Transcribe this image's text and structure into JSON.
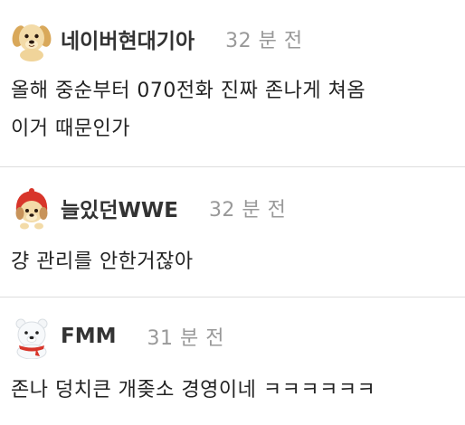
{
  "comments": [
    {
      "avatar_icon": "puppy-avatar-icon",
      "username": "네이버현대기아",
      "time": "32 분 전",
      "line1": "올해 중순부터 070전화 진짜 존나게 쳐옴",
      "line2": "이거 때문인가"
    },
    {
      "avatar_icon": "puppy-red-hood-avatar-icon",
      "username": "늘있던WWE",
      "time": "32 분 전",
      "line1": "걍 관리를 안한거잖아"
    },
    {
      "avatar_icon": "polar-bear-avatar-icon",
      "username": "FMM",
      "time": "31 분 전",
      "line1": "존나 덩치큰 개좆소 경영이네 ㅋㅋㅋㅋㅋㅋ"
    }
  ],
  "colors": {
    "username": "#333333",
    "time": "#999999",
    "text": "#222222",
    "divider": "#dddddd"
  }
}
